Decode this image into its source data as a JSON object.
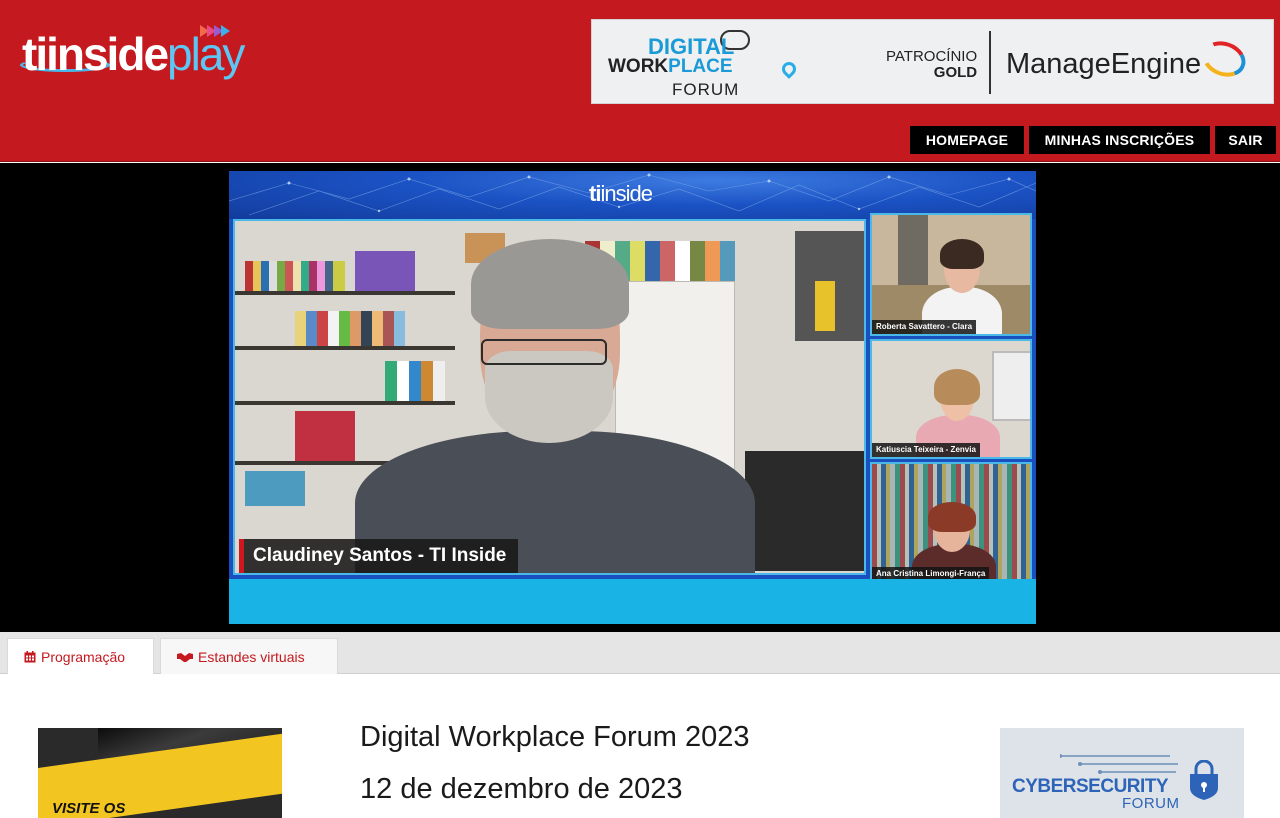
{
  "header": {
    "logo": {
      "part1": "tiinside",
      "part2": "play"
    },
    "banner": {
      "event_line1": "DIGITAL",
      "event_line2a": "WORK",
      "event_line2b": "PLACE",
      "event_line3": "FORUM",
      "sponsor_label": "PATROCÍNIO",
      "sponsor_tier": "GOLD",
      "sponsor_name": "ManageEngine"
    },
    "nav": [
      {
        "label": "HOMEPAGE"
      },
      {
        "label": "MINHAS INSCRIÇÕES"
      },
      {
        "label": "SAIR"
      }
    ]
  },
  "video": {
    "watermark": {
      "part1": "ti",
      "part2": "inside"
    },
    "main_speaker": "Claudiney Santos - TI Inside",
    "participants": [
      {
        "label": "Roberta Savattero - Clara"
      },
      {
        "label": "Katiuscia Teixeira - Zenvia"
      },
      {
        "label": "Ana Cristina Limongi-França"
      }
    ]
  },
  "tabs": [
    {
      "label": "Programação",
      "icon": "calendar-icon",
      "active": true
    },
    {
      "label": "Estandes virtuais",
      "icon": "handshake-icon",
      "active": false
    }
  ],
  "content": {
    "left_ad": "VISITE OS",
    "event_title": "Digital Workplace Forum 2023",
    "event_date": "12 de dezembro de 2023",
    "right_ad": {
      "title": "CYBERSECURITY",
      "subtitle": "FORUM"
    }
  },
  "colors": {
    "brand_red": "#c4191f",
    "accent_blue": "#19b3e6",
    "nav_black": "#000000"
  }
}
